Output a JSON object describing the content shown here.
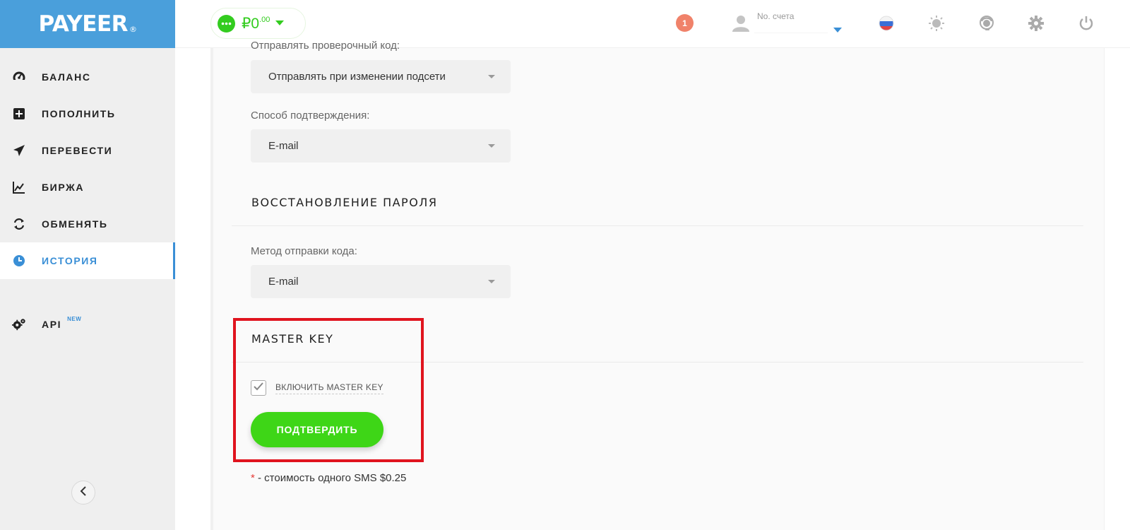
{
  "logo": {
    "text": "PAYEER",
    "reg": "®"
  },
  "sidebar": {
    "items": [
      {
        "label": "БАЛАНС",
        "icon": "speedometer-icon"
      },
      {
        "label": "ПОПОЛНИТЬ",
        "icon": "plus-square-icon"
      },
      {
        "label": "ПЕРЕВЕСТИ",
        "icon": "paper-plane-icon"
      },
      {
        "label": "БИРЖА",
        "icon": "chart-icon"
      },
      {
        "label": "ОБМЕНЯТЬ",
        "icon": "exchange-icon"
      },
      {
        "label": "ИСТОРИЯ",
        "icon": "clock-icon",
        "active": true
      }
    ],
    "api": {
      "label": "API",
      "badge": "NEW",
      "icon": "gears-icon"
    }
  },
  "header": {
    "balance": {
      "currency": "₽",
      "integer": "0",
      "decimal": ".00"
    },
    "notifications_count": "1",
    "account_label": "No. счета",
    "account_value": "",
    "icons": [
      "russia-flag-icon",
      "theme-sun-icon",
      "support-icon",
      "settings-gear-icon",
      "power-icon"
    ]
  },
  "main": {
    "partial_label": "Отправлять проверочный код:",
    "send_code_select": "Отправлять при изменении подсети",
    "confirm_method_label": "Способ подтверждения:",
    "confirm_method_select": "E-mail",
    "password_recovery_title": "ВОССТАНОВЛЕНИЕ ПАРОЛЯ",
    "recovery_method_label": "Метод отправки кода:",
    "recovery_method_select": "E-mail",
    "master_key_title": "MASTER KEY",
    "enable_master_key_label": "ВКЛЮЧИТЬ MASTER KEY",
    "enable_master_key_checked": true,
    "confirm_button": "ПОДТВЕРДИТЬ",
    "footnote_star": "*",
    "footnote_text": " - стоимость одного SMS $0.25"
  },
  "colors": {
    "brand_blue": "#4a9fdb",
    "accent_green": "#3ed617",
    "highlight_red": "#e0141e",
    "active_blue": "#3a8fd6"
  }
}
